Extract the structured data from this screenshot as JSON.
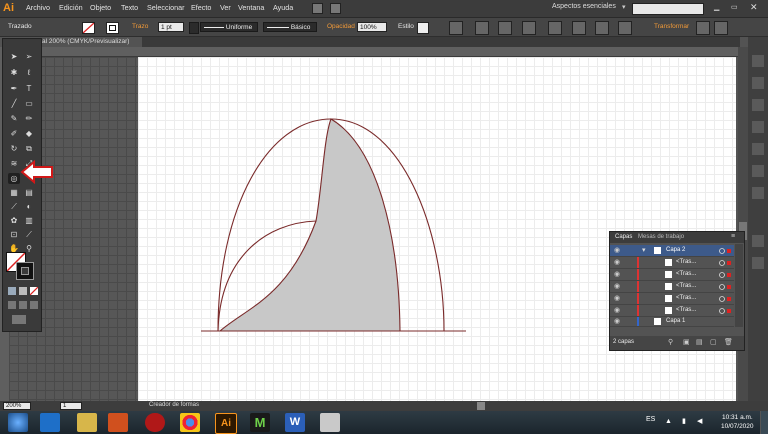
{
  "app": {
    "logo": "Ai"
  },
  "menu": [
    "Archivo",
    "Edición",
    "Objeto",
    "Texto",
    "Seleccionar",
    "Efecto",
    "Ver",
    "Ventana",
    "Ayuda"
  ],
  "workspace": "Aspectos esenciales",
  "control": {
    "object_type": "Trazado",
    "stroke_label": "Trazo",
    "stroke_weight": "1 pt",
    "profile": "Uniforme",
    "brush": "Básico",
    "opacity_label": "Opacidad",
    "opacity_value": "100%",
    "style_label": "Estilo",
    "transform_label": "Transformar"
  },
  "document_tab": "al 200% (CMYK/Previsualizar)",
  "layers_panel": {
    "tab_layers": "Capas",
    "tab_artboards": "Mesas de trabajo",
    "layer_top": "Capa 2",
    "items": [
      "<Tras...",
      "<Tras...",
      "<Tras...",
      "<Tras...",
      "<Tras..."
    ],
    "layer_bottom": "Capa 1",
    "count": "2 capas"
  },
  "status": {
    "zoom": "200%",
    "page": "1",
    "tool_name": "Creador de formas"
  },
  "taskbar": {
    "lang": "ES",
    "time": "10:31 a.m.",
    "date": "10/07/2020"
  },
  "colors": {
    "accent": "#f7941d",
    "shape_stroke": "#7a2a2a",
    "shape_fill": "#c8c8c8",
    "layer_highlight": "#3d5a8a"
  },
  "icons": [
    "selection-icon",
    "direct-selection-icon",
    "magic-wand-icon",
    "lasso-icon",
    "pen-icon",
    "type-icon",
    "line-icon",
    "rectangle-icon",
    "paintbrush-icon",
    "pencil-icon",
    "blob-brush-icon",
    "eraser-icon",
    "rotate-icon",
    "scale-icon",
    "width-icon",
    "free-transform-icon",
    "shape-builder-icon",
    "perspective-icon",
    "mesh-icon",
    "gradient-icon",
    "eyedropper-icon",
    "blend-icon",
    "symbol-sprayer-icon",
    "graph-icon",
    "artboard-icon",
    "slice-icon",
    "hand-icon",
    "zoom-icon",
    "red-arrow-icon"
  ]
}
